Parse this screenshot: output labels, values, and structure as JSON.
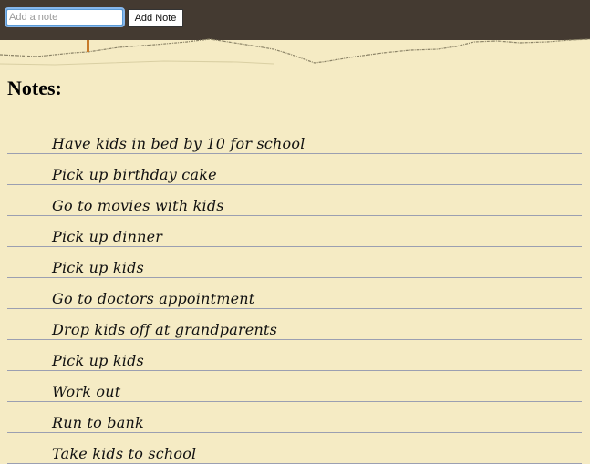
{
  "form": {
    "input_placeholder": "Add a note",
    "input_value": "",
    "add_button_label": "Add Note"
  },
  "heading": "Notes:",
  "notes": [
    "Have kids in bed by 10 for school",
    "Pick up birthday cake",
    "Go to movies with kids",
    "Pick up dinner",
    "Pick up kids",
    "Go to doctors appointment",
    "Drop kids off at grandparents",
    "Pick up kids",
    "Work out",
    "Run to bank",
    "Take kids to school"
  ],
  "colors": {
    "topbar": "#443a31",
    "paper": "#f5ebc4",
    "rule_line": "#9b9fb1"
  }
}
